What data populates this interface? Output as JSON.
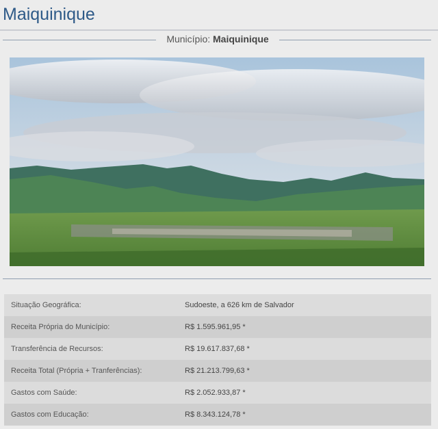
{
  "header": {
    "title": "Maiquinique"
  },
  "subtitle": {
    "label": "Município:",
    "name": "Maiquinique"
  },
  "info_rows": [
    {
      "label": "Situação Geográfica:",
      "value": "Sudoeste, a 626 km de Salvador"
    },
    {
      "label": "Receita Própria do Município:",
      "value": "R$ 1.595.961,95 *"
    },
    {
      "label": "Transferência de Recursos:",
      "value": "R$ 19.617.837,68 *"
    },
    {
      "label": "Receita Total (Própria + Tranferências):",
      "value": "R$ 21.213.799,63 *"
    },
    {
      "label": "Gastos com Saúde:",
      "value": "R$ 2.052.933,87 *"
    },
    {
      "label": "Gastos com Educação:",
      "value": "R$ 8.343.124,78 *"
    }
  ],
  "colors": {
    "title": "#2e5a88",
    "page_background": "#ececec",
    "row_light": "#dcdcdc",
    "row_dark": "#cfcfcf"
  }
}
